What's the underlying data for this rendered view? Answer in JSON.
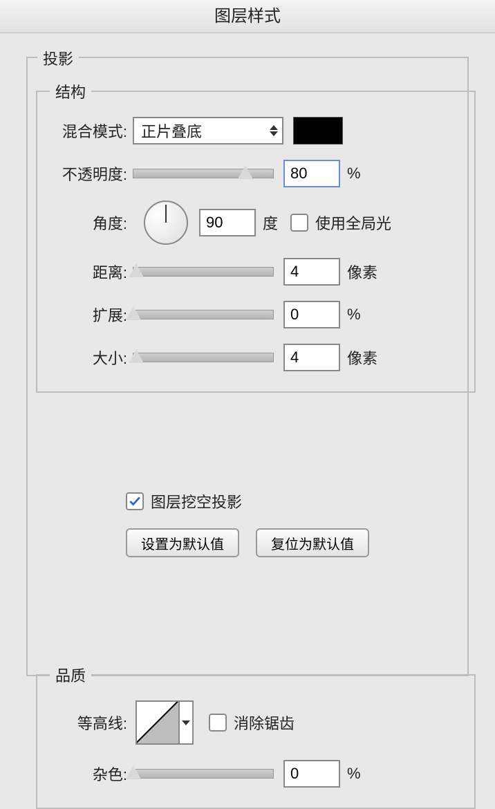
{
  "dialog": {
    "title": "图层样式"
  },
  "section": {
    "name": "投影"
  },
  "structure": {
    "legend": "结构",
    "blend_mode_label": "混合模式:",
    "blend_mode_value": "正片叠底",
    "color_hex": "#000000",
    "opacity_label": "不透明度:",
    "opacity_value": "80",
    "opacity_unit": "%",
    "opacity_percent": 80,
    "angle_label": "角度:",
    "angle_value": "90",
    "angle_unit": "度",
    "global_light_label": "使用全局光",
    "global_light_checked": false,
    "distance_label": "距离:",
    "distance_value": "4",
    "distance_unit": "像素",
    "distance_percent": 2,
    "spread_label": "扩展:",
    "spread_value": "0",
    "spread_unit": "%",
    "spread_percent": 0,
    "size_label": "大小:",
    "size_value": "4",
    "size_unit": "像素",
    "size_percent": 2
  },
  "quality": {
    "legend": "品质",
    "contour_label": "等高线:",
    "antialias_label": "消除锯齿",
    "antialias_checked": false,
    "noise_label": "杂色:",
    "noise_value": "0",
    "noise_unit": "%",
    "noise_percent": 0
  },
  "footer": {
    "knockout_label": "图层挖空投影",
    "knockout_checked": true,
    "set_default": "设置为默认值",
    "reset_default": "复位为默认值"
  }
}
